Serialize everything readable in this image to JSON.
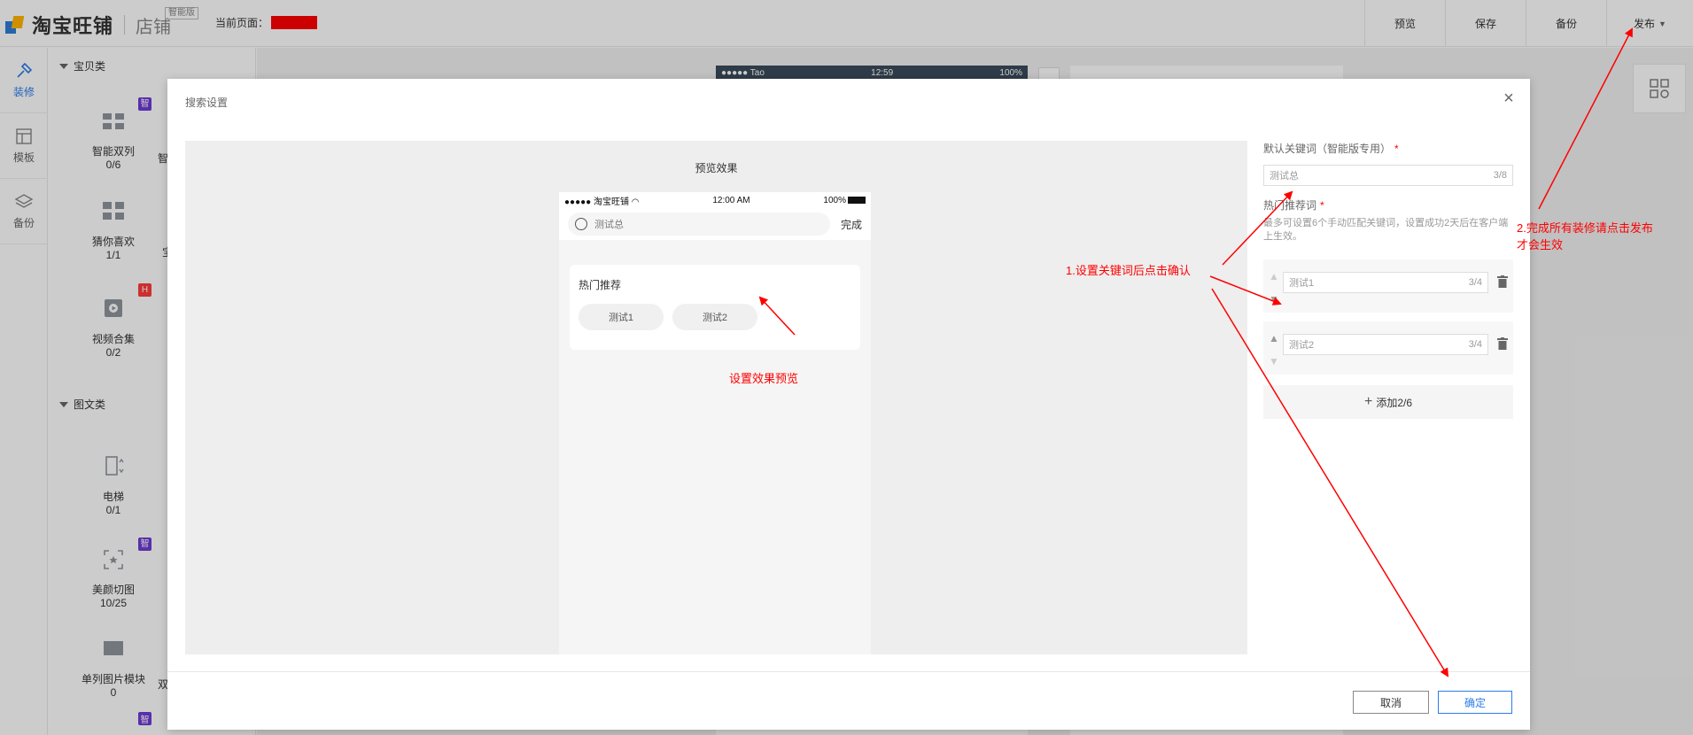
{
  "header": {
    "logo_text": "淘宝旺铺",
    "logo_sub": "店铺",
    "logo_badge": "智能版",
    "current_page_label": "当前页面：",
    "actions": [
      "预览",
      "保存",
      "备份",
      "发布"
    ]
  },
  "leftnav": {
    "items": [
      {
        "label": "装修",
        "icon": "brush-icon",
        "active": true
      },
      {
        "label": "模板",
        "icon": "template-icon",
        "active": false
      },
      {
        "label": "备份",
        "icon": "layers-icon",
        "active": false
      }
    ],
    "help": "?"
  },
  "modules": {
    "category1": "宝贝类",
    "category2": "图文类",
    "items": [
      {
        "name": "智能双列",
        "count": "0/6",
        "tag": "智"
      },
      {
        "name": "猜你喜欢",
        "count": "1/1",
        "tag": ""
      },
      {
        "name": "视频合集",
        "count": "0/2",
        "tag": "H"
      },
      {
        "name": "电梯",
        "count": "0/1",
        "tag": ""
      },
      {
        "name": "美颜切图",
        "count": "10/25",
        "tag": "智"
      },
      {
        "name": "单列图片模块",
        "count": "0",
        "tag": ""
      }
    ],
    "clipped": [
      "智",
      "宝",
      "双"
    ]
  },
  "canvas": {
    "status_carrier": "●●●●● Tao",
    "status_time": "12:59",
    "status_battery": "100%"
  },
  "modal": {
    "title": "搜索设置",
    "close": "×",
    "preview_label": "预览效果",
    "phone": {
      "carrier": "●●●●● 淘宝旺铺",
      "time": "12:00 AM",
      "battery": "100%",
      "search_text": "测试总",
      "done": "完成",
      "hot_title": "热门推荐",
      "chips": [
        "测试1",
        "测试2"
      ]
    },
    "settings": {
      "default_kw_label": "默认关键词（智能版专用）",
      "default_kw_required": "*",
      "default_kw_value": "测试总",
      "default_kw_count": "3/8",
      "hot_label": "热门推荐词",
      "hot_required": "*",
      "hint": "最多可设置6个手动匹配关键词，设置成功2天后在客户端上生效。",
      "keywords": [
        {
          "value": "测试1",
          "count": "3/4"
        },
        {
          "value": "测试2",
          "count": "3/4"
        }
      ],
      "add_label": "添加2/6"
    },
    "footer": {
      "cancel": "取消",
      "ok": "确定"
    }
  },
  "annotations": {
    "preview": "设置效果预览",
    "step1": "1.设置关键词后点击确认",
    "step2_line1": "2.完成所有装修请点击发布",
    "step2_line2": "才会生效",
    "color": "#ff0000"
  }
}
